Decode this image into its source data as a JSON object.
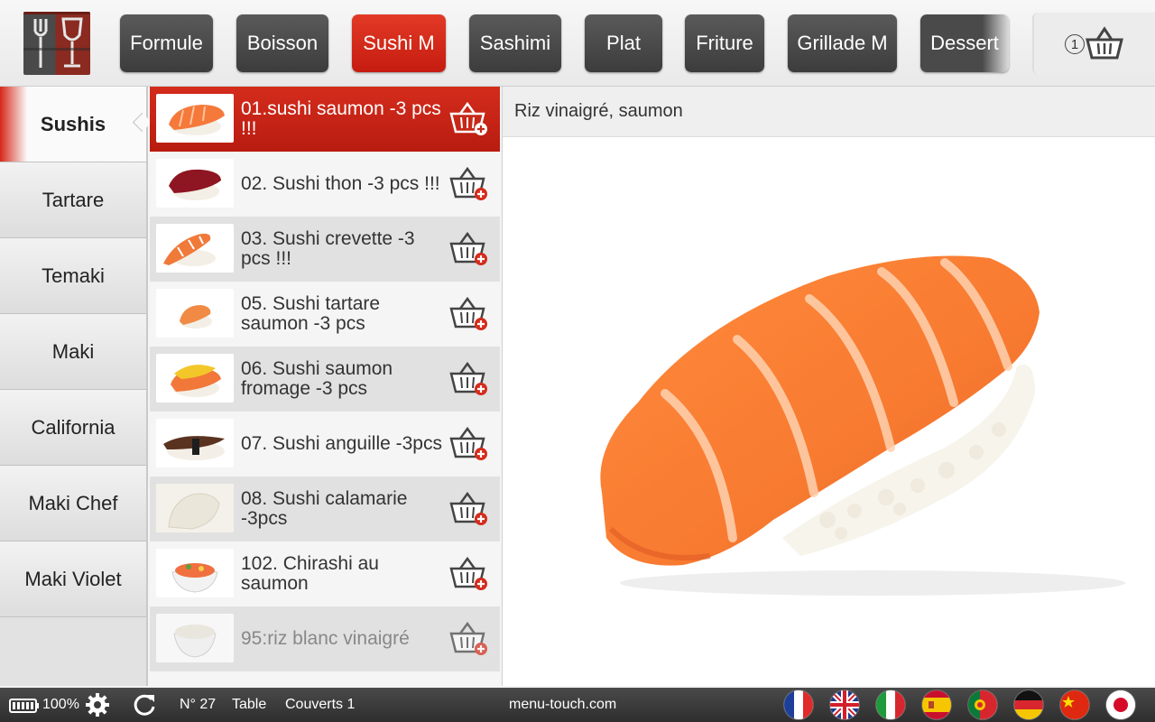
{
  "header": {
    "tabs": [
      {
        "label": "Formule",
        "active": false
      },
      {
        "label": "Boisson",
        "active": false
      },
      {
        "label": "Sushi M",
        "active": true
      },
      {
        "label": "Sashimi",
        "active": false
      },
      {
        "label": "Plat",
        "active": false
      },
      {
        "label": "Friture",
        "active": false
      },
      {
        "label": "Grillade M",
        "active": false
      },
      {
        "label": "Dessert",
        "active": false
      }
    ],
    "cart_count": "1",
    "accent_color": "#d42c1c"
  },
  "sidebar": {
    "items": [
      {
        "label": "Sushis",
        "active": true
      },
      {
        "label": "Tartare",
        "active": false
      },
      {
        "label": "Temaki",
        "active": false
      },
      {
        "label": "Maki",
        "active": false
      },
      {
        "label": "California",
        "active": false
      },
      {
        "label": "Maki Chef",
        "active": false
      },
      {
        "label": "Maki Violet",
        "active": false
      }
    ]
  },
  "menu_list": {
    "items": [
      {
        "name": "01.sushi saumon -3 pcs !!!",
        "selected": true
      },
      {
        "name": "02. Sushi thon -3 pcs !!!"
      },
      {
        "name": "03. Sushi crevette -3 pcs !!!"
      },
      {
        "name": "05. Sushi tartare saumon -3 pcs"
      },
      {
        "name": "06. Sushi saumon fromage -3 pcs"
      },
      {
        "name": "07. Sushi anguille -3pcs"
      },
      {
        "name": "08. Sushi calamarie -3pcs"
      },
      {
        "name": "102. Chirashi au saumon"
      },
      {
        "name": "95:riz blanc vinaigré"
      }
    ]
  },
  "detail": {
    "description": "Riz vinaigré, saumon"
  },
  "status_bar": {
    "battery": "100%",
    "number": "N° 27",
    "table": "Table",
    "couverts": "Couverts 1",
    "site": "menu-touch.com",
    "languages": [
      "french-flag",
      "uk-flag",
      "italian-flag",
      "spanish-flag",
      "portuguese-flag",
      "german-flag",
      "chinese-flag",
      "japanese-flag"
    ]
  }
}
